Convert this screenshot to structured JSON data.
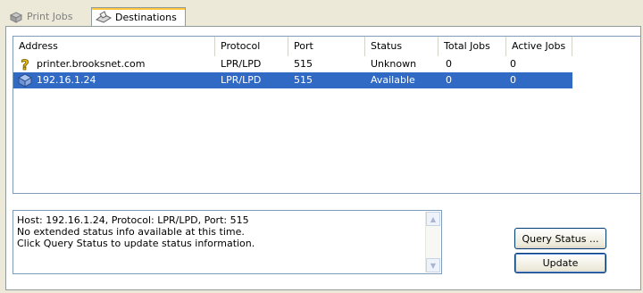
{
  "tabs": {
    "print_jobs": "Print Jobs",
    "destinations": "Destinations",
    "active": "Destinations"
  },
  "table": {
    "headers": [
      "Address",
      "Protocol",
      "Port",
      "Status",
      "Total Jobs",
      "Active Jobs"
    ],
    "rows": [
      {
        "icon": "question-icon",
        "address": "printer.brooksnet.com",
        "protocol": "LPR/LPD",
        "port": "515",
        "status": "Unknown",
        "total": "0",
        "active": "0",
        "selected": false
      },
      {
        "icon": "printer-icon",
        "address": "192.16.1.24",
        "protocol": "LPR/LPD",
        "port": "515",
        "status": "Available",
        "total": "0",
        "active": "0",
        "selected": true
      }
    ]
  },
  "info": {
    "lines": [
      "Host: 192.16.1.24, Protocol: LPR/LPD, Port: 515",
      "No extended status info available at this time.",
      "Click Query Status to update status information."
    ]
  },
  "buttons": {
    "query_status": "Query Status ...",
    "update": "Update"
  },
  "colors": {
    "selection": "#316ac5",
    "window_bg": "#ece9d8",
    "border": "#7f9db9"
  }
}
